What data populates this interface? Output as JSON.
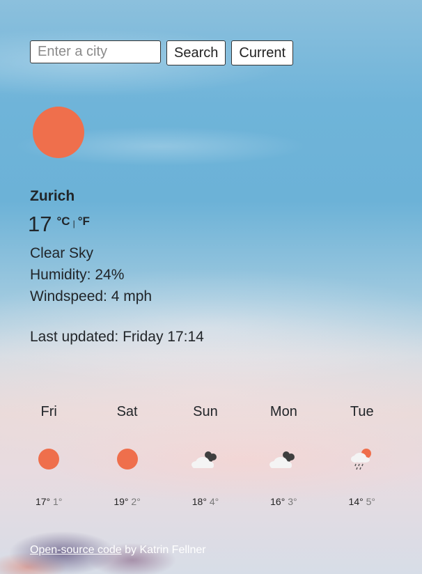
{
  "search": {
    "placeholder": "Enter a city",
    "search_label": "Search",
    "current_label": "Current"
  },
  "current": {
    "icon": "sun-icon",
    "city": "Zurich",
    "temperature": "17",
    "unit_c": "°C",
    "unit_separator": "|",
    "unit_f": "°F",
    "description": "Clear Sky",
    "humidity": "Humidity: 24%",
    "windspeed": "Windspeed: 4 mph",
    "last_updated": "Last updated: Friday 17:14"
  },
  "forecast": [
    {
      "day": "Fri",
      "icon": "sun-icon",
      "max": "17°",
      "min": "1°"
    },
    {
      "day": "Sat",
      "icon": "sun-icon",
      "max": "19°",
      "min": "2°"
    },
    {
      "day": "Sun",
      "icon": "cloud-icon",
      "max": "18°",
      "min": "4°"
    },
    {
      "day": "Mon",
      "icon": "cloud-icon",
      "max": "16°",
      "min": "3°"
    },
    {
      "day": "Tue",
      "icon": "rain-sun-icon",
      "max": "14°",
      "min": "5°"
    }
  ],
  "footer": {
    "link_text": "Open-source code",
    "author_text": "by Katrin Fellner"
  },
  "colors": {
    "sun": "#ef6f4c",
    "cloud_dark": "#3f3f3f",
    "text": "#212529"
  }
}
